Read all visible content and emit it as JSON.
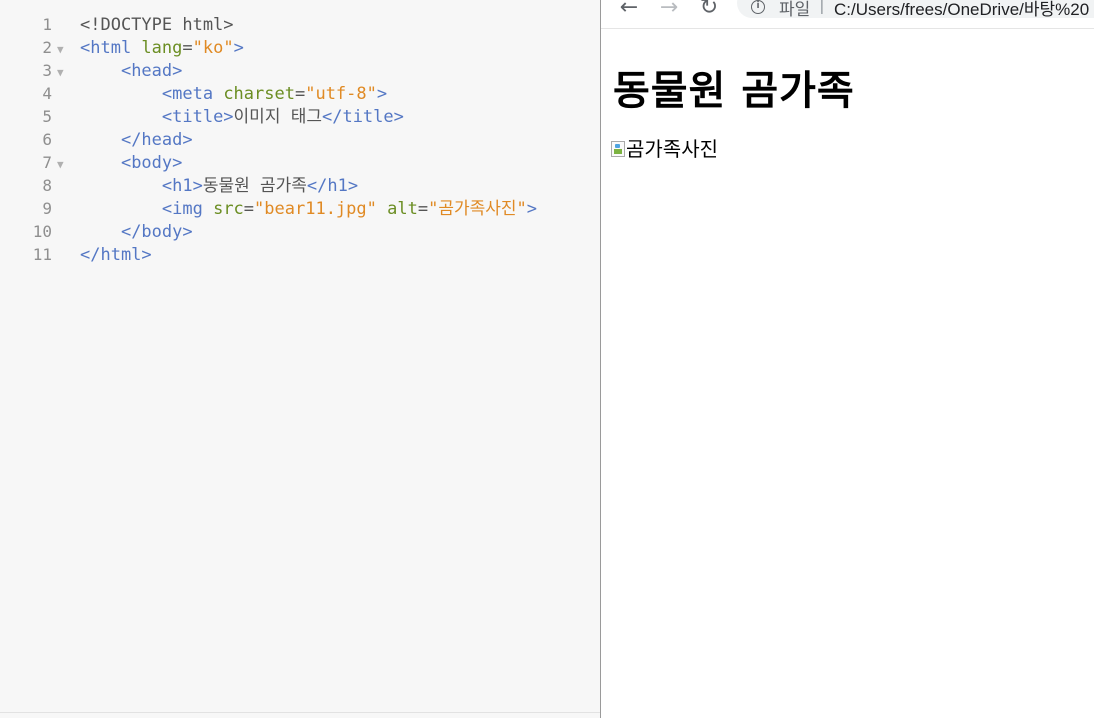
{
  "editor": {
    "lines": [
      {
        "num": "1",
        "fold": "",
        "parts": [
          {
            "c": "doc",
            "t": "<!DOCTYPE html>"
          }
        ]
      },
      {
        "num": "2",
        "fold": "▼",
        "parts": [
          {
            "c": "tag",
            "t": "<html "
          },
          {
            "c": "attr",
            "t": "lang"
          },
          {
            "c": "txt",
            "t": "="
          },
          {
            "c": "str",
            "t": "\"ko\""
          },
          {
            "c": "tag",
            "t": ">"
          }
        ]
      },
      {
        "num": "3",
        "fold": "▼",
        "parts": [
          {
            "c": "txt",
            "t": "    "
          },
          {
            "c": "tag",
            "t": "<head>"
          }
        ]
      },
      {
        "num": "4",
        "fold": "",
        "parts": [
          {
            "c": "txt",
            "t": "        "
          },
          {
            "c": "tag",
            "t": "<meta "
          },
          {
            "c": "attr",
            "t": "charset"
          },
          {
            "c": "txt",
            "t": "="
          },
          {
            "c": "str",
            "t": "\"utf-8\""
          },
          {
            "c": "tag",
            "t": ">"
          }
        ]
      },
      {
        "num": "5",
        "fold": "",
        "parts": [
          {
            "c": "txt",
            "t": "        "
          },
          {
            "c": "tag",
            "t": "<title>"
          },
          {
            "c": "txt",
            "t": "이미지 태그"
          },
          {
            "c": "tag",
            "t": "</title>"
          }
        ]
      },
      {
        "num": "6",
        "fold": "",
        "parts": [
          {
            "c": "txt",
            "t": "    "
          },
          {
            "c": "tag",
            "t": "</head>"
          }
        ]
      },
      {
        "num": "7",
        "fold": "▼",
        "parts": [
          {
            "c": "txt",
            "t": "    "
          },
          {
            "c": "tag",
            "t": "<body>"
          }
        ]
      },
      {
        "num": "8",
        "fold": "",
        "parts": [
          {
            "c": "txt",
            "t": "        "
          },
          {
            "c": "tag",
            "t": "<h1>"
          },
          {
            "c": "txt",
            "t": "동물원 곰가족"
          },
          {
            "c": "tag",
            "t": "</h1>"
          }
        ]
      },
      {
        "num": "9",
        "fold": "",
        "parts": [
          {
            "c": "txt",
            "t": "        "
          },
          {
            "c": "tag",
            "t": "<img "
          },
          {
            "c": "attr",
            "t": "src"
          },
          {
            "c": "txt",
            "t": "="
          },
          {
            "c": "str",
            "t": "\"bear11.jpg\""
          },
          {
            "c": "txt",
            "t": " "
          },
          {
            "c": "attr",
            "t": "alt"
          },
          {
            "c": "txt",
            "t": "="
          },
          {
            "c": "str",
            "t": "\"곰가족사진\""
          },
          {
            "c": "tag",
            "t": ">"
          }
        ]
      },
      {
        "num": "10",
        "fold": "",
        "parts": [
          {
            "c": "txt",
            "t": "    "
          },
          {
            "c": "tag",
            "t": "</body>"
          }
        ]
      },
      {
        "num": "11",
        "fold": "",
        "parts": [
          {
            "c": "tag",
            "t": "</html>"
          }
        ]
      }
    ]
  },
  "browser": {
    "back_icon": "←",
    "forward_icon": "→",
    "reload_icon": "↻",
    "info_icon": "i",
    "url_scheme": "파일",
    "url_separator": "|",
    "url": "C:/Users/frees/OneDrive/바탕%20",
    "page": {
      "heading": "동물원 곰가족",
      "image_alt": "곰가족사진"
    }
  }
}
